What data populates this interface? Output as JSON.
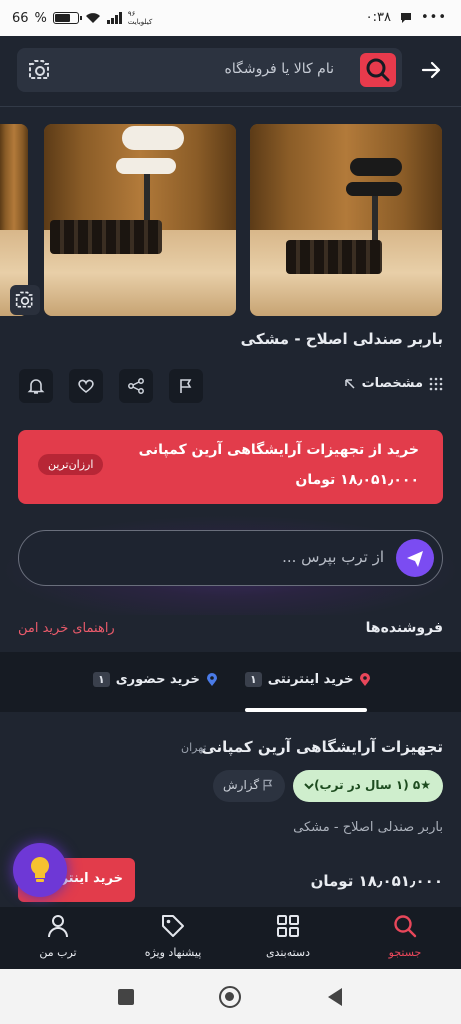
{
  "status_bar": {
    "time": "۰:۳۸",
    "battery": "66",
    "network": "۹۶ کیلوبایت"
  },
  "search": {
    "placeholder": "نام کالا یا فروشگاه"
  },
  "product": {
    "title": "باربر صندلی اصلاح - مشکی",
    "specs_label": "مشخصات"
  },
  "promo": {
    "line1": "خرید از تجهیزات آرایشگاهی آرین کمپانی",
    "line2": "۱۸٫۰۵۱٫۰۰۰ تومان",
    "tag": "ارزان‌ترین"
  },
  "ask": {
    "placeholder": "از ترب بپرس ..."
  },
  "sellers": {
    "title": "فروشنده‌ها",
    "guide_link": "راهنمای خرید امن"
  },
  "tabs": [
    {
      "label": "خرید اینترنتی",
      "count": "۱"
    },
    {
      "label": "خرید حضوری",
      "count": "۱"
    }
  ],
  "seller": {
    "name": "تجهیزات آرایشگاهی آرین کمپانی",
    "city": "تهران",
    "rating": "★۵ (۱ سال در ترب)",
    "report_label": "گزارش",
    "product_name": "باربر صندلی اصلاح - مشکی",
    "price": "۱۸٫۰۵۱٫۰۰۰ تومان",
    "buy_label": "خرید اینترنتی"
  },
  "bottom_nav": [
    {
      "label": "جستجو",
      "active": true
    },
    {
      "label": "دسته‌بندی",
      "active": false
    },
    {
      "label": "پیشنهاد ویژه",
      "active": false
    },
    {
      "label": "ترب من",
      "active": false
    }
  ],
  "colors": {
    "accent": "#e23c4b",
    "background": "#1f2530",
    "ai": "#7b4cf2"
  }
}
